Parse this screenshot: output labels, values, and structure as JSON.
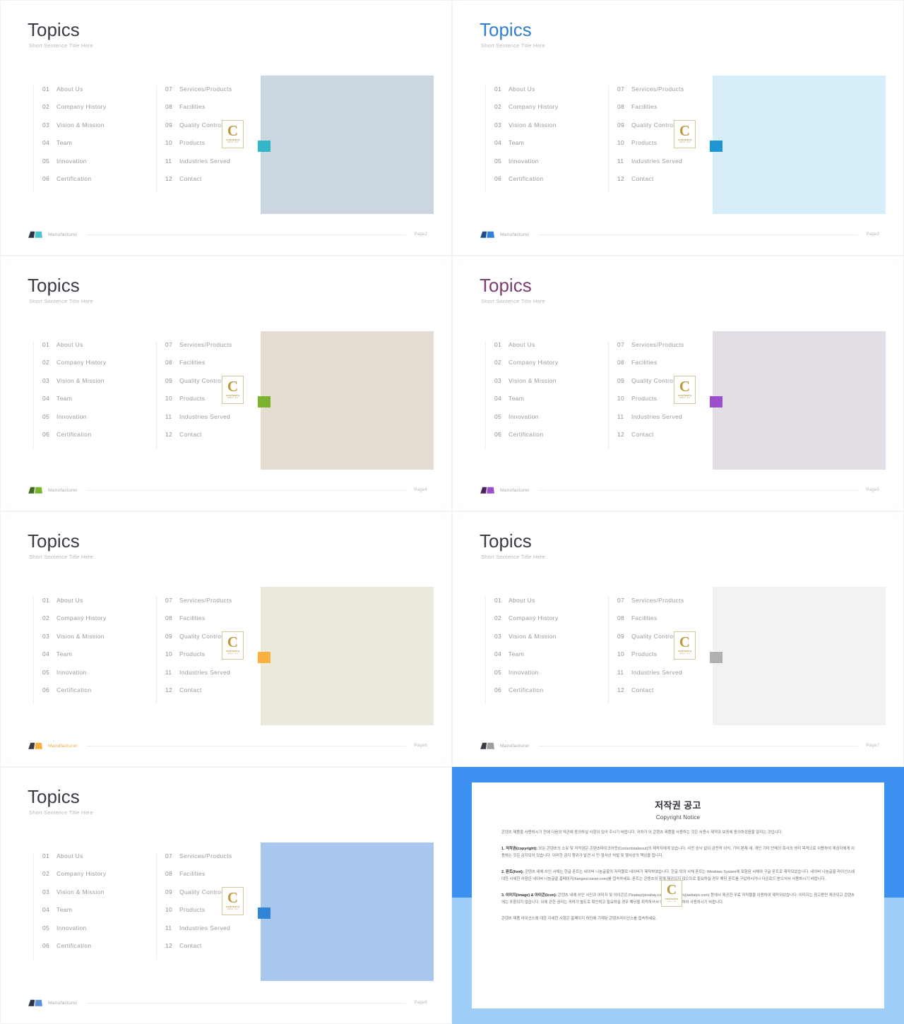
{
  "common": {
    "title": "Topics",
    "subtitle": "Short Sentence Title Here",
    "brand": "Manufacturer",
    "badge": {
      "letter": "C",
      "line1": "CONTENTS",
      "line2": "TABLE / LIST"
    },
    "items_left": [
      {
        "num": "01",
        "label": "About Us"
      },
      {
        "num": "02",
        "label": "Company History"
      },
      {
        "num": "03",
        "label": "Vision & Mission"
      },
      {
        "num": "04",
        "label": "Team"
      },
      {
        "num": "05",
        "label": "Innovation"
      },
      {
        "num": "06",
        "label": "Certification"
      }
    ],
    "items_right": [
      {
        "num": "07",
        "label": "Services/Products"
      },
      {
        "num": "08",
        "label": "Facilities"
      },
      {
        "num": "09",
        "label": "Quality Control"
      },
      {
        "num": "10",
        "label": "Products"
      },
      {
        "num": "11",
        "label": "Industries Served"
      },
      {
        "num": "12",
        "label": "Contact"
      }
    ]
  },
  "slides": [
    {
      "id": "slide-teal",
      "page": "Page2",
      "title_color": "#3b3b45",
      "panel_color": "#ccd6e0",
      "accent_color": "#35b6c6",
      "logo_dark": "#2b3147",
      "logo_light": "#4ec3cf",
      "brand_color": "#a6a6ae"
    },
    {
      "id": "slide-blue",
      "page": "Page3",
      "title_color": "#2f7fd6",
      "panel_color": "#d6edfa",
      "accent_color": "#1e95d4",
      "logo_dark": "#1b4f8f",
      "logo_light": "#2f82d6",
      "brand_color": "#a6a6ae"
    },
    {
      "id": "slide-green",
      "page": "Page4",
      "title_color": "#3b3b45",
      "panel_color": "#e3ded1",
      "accent_color": "#7bb32e",
      "logo_dark": "#3f6b20",
      "logo_light": "#7bb32e",
      "brand_color": "#a6a6ae"
    },
    {
      "id": "slide-purple",
      "page": "Page5",
      "title_color": "#7d3b72",
      "panel_color": "#e3dee6",
      "accent_color": "#9b4fcd",
      "logo_dark": "#4b2259",
      "logo_light": "#9b4fcd",
      "brand_color": "#a6a6ae"
    },
    {
      "id": "slide-orange",
      "page": "Page6",
      "title_color": "#3b3b45",
      "panel_color": "#ebe8dc",
      "accent_color": "#f7b13c",
      "logo_dark": "#3b3b45",
      "logo_light": "#f7b13c",
      "brand_color": "#f0a93a"
    },
    {
      "id": "slide-gray",
      "page": "Page7",
      "title_color": "#3b3b45",
      "panel_color": "#f2f2f2",
      "accent_color": "#b0b0b0",
      "logo_dark": "#3b3b45",
      "logo_light": "#9e9e9e",
      "brand_color": "#a6a6ae"
    },
    {
      "id": "slide-skyblue",
      "page": "Page8",
      "title_color": "#3b3b45",
      "panel_color": "#a9c6ef",
      "accent_color": "#2f86d6",
      "logo_dark": "#2b3147",
      "logo_light": "#5b8fd9",
      "brand_color": "#a6a6ae"
    }
  ],
  "copyright": {
    "heading_ko": "저작권 공고",
    "heading_en": "Copyright Notice",
    "intro": "콘텐츠 제품을 사용하시기 전에 다음의 약관에 동의하실 사항이 있어 주시기 바랍니다. 귀하가 이 콘텐츠 제품을 사용하는 것은 사용시 제약과 보증에 동의하셨음을 알리는 것입니다.",
    "p1_label": "1. 저작권(copyright):",
    "p1_body": " 모든 콘텐츠의 소유 및 저작권은 콘텐츠테이크아웃(Contentstakeout)의 제작자에게 있습니다. 사전 승낙 없이 금전적 이익, 기타 편재 새, 개인 기타 단체의 회사의 영리 목적으로 이용하여 제삼자에게 이용하는 것은 금지되어 있습니다. 이러한 금지 행위가 발견 시 민·형사상 처벌 및 행사상의 책임을 됩니다.",
    "p2_label": "2. 폰트(font):",
    "p2_body": " 콘텐츠 내에 쓰인 서체는 한글 폰트는 네이버 나눔글꼴의 저작물로 네이버가 제작하였습니다. 한글 외의 서체 폰트는 Windows System에 포함된 서체와 구글 폰트로 제작되었습니다. 네이버 나눔글꼴 라이선스에 대한 사세한 사항은 네이버 나눔글꼴 홈페이지(hangeul.naver.com)를 접속하세요. 폰트는 콘텐츠와 함께 제공되지 않으므로 필요하실 경우 해당 폰트를 구입하시거나 다운로드 받으셔서 사용하시기 바랍니다.",
    "p3_label": "3. 이미지(image) & 아이콘(icon):",
    "p3_body": " 콘텐츠 내에 쓰인 사진과 이미지 및 아이콘은 Pixabay(pixabay.com)과 Webalys(webalys.com) 등에서 제공한 무료 저작물을 이용하여 제작되었습니다. 이미지는 참고용만 제공되고 콘텐츠에는 포함되지 않습니다. 이에 관한 권리는 귀하가 별도로 확인하고 필요하실 경우 해당을 취득하셔서 이미지를 반영하여 사용하시기 바랍니다.",
    "footer_note": "콘텐츠 제품 라이선스에 대한 자세한 사항은 홈페이지 하단에 기재된 콘텐츠라이선스를 접속하세요."
  }
}
